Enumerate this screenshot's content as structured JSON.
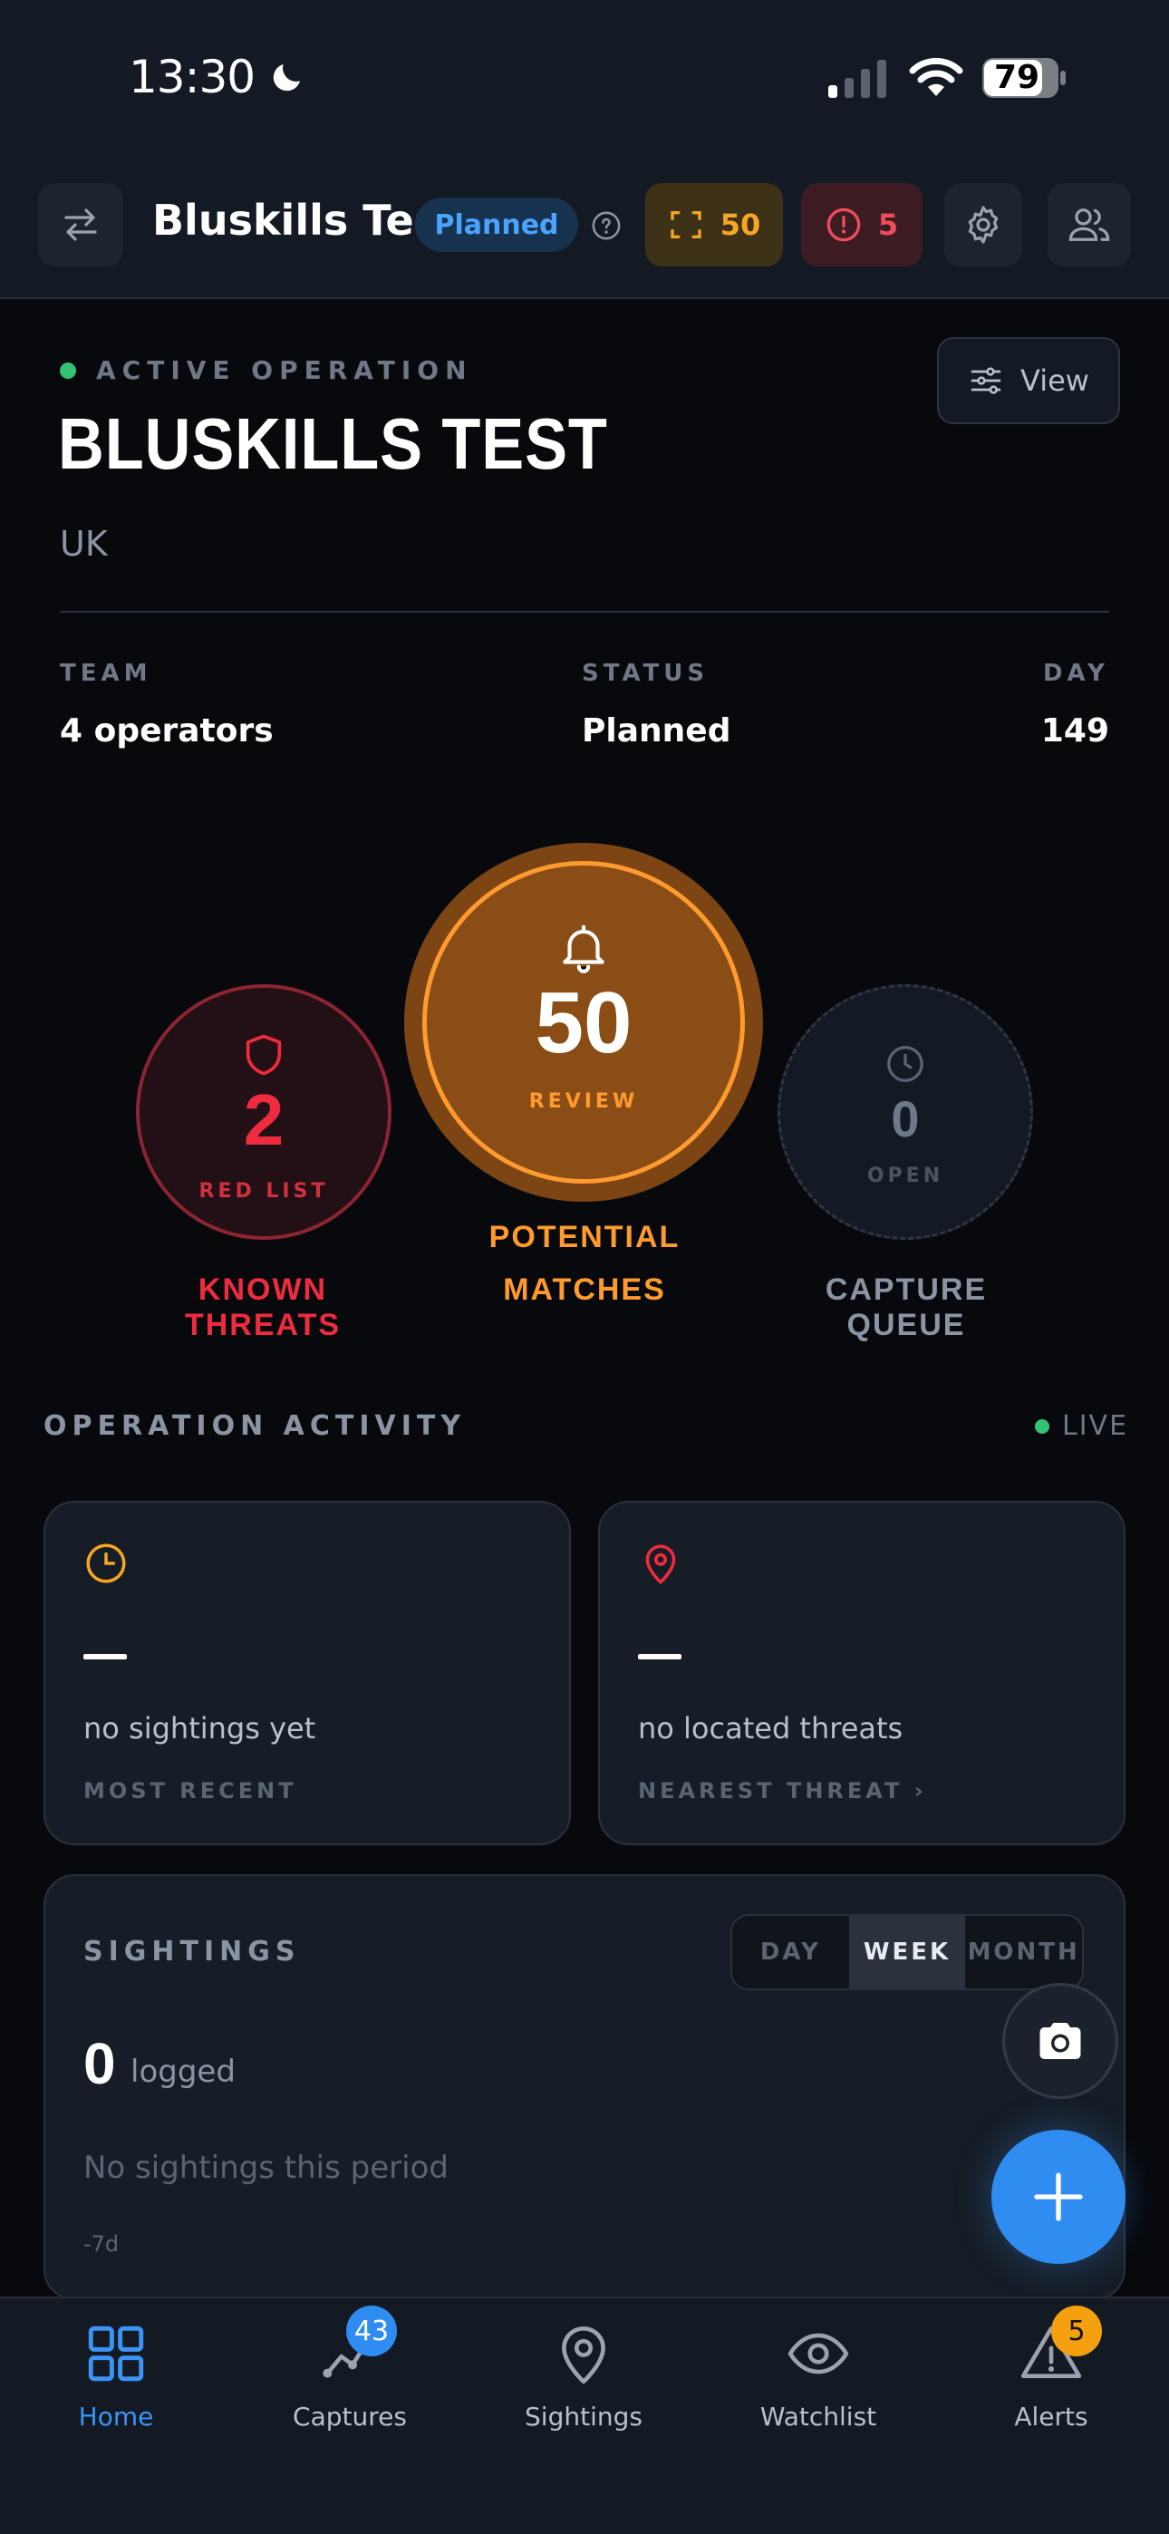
{
  "status_bar": {
    "time": "13:30",
    "battery": "79"
  },
  "header": {
    "title": "Bluskills Test",
    "status_badge": "Planned",
    "captures_count": "50",
    "alerts_count": "5"
  },
  "operation": {
    "label": "ACTIVE OPERATION",
    "title": "BLUSKILLS TEST",
    "location": "UK",
    "view_label": "View",
    "team_label": "TEAM",
    "team_value": "4 operators",
    "status_label": "STATUS",
    "status_value": "Planned",
    "day_label": "DAY",
    "day_value": "149"
  },
  "metrics": {
    "known_threats": {
      "value": "2",
      "sub": "RED LIST",
      "caption": "KNOWN THREATS"
    },
    "potential_matches": {
      "value": "50",
      "sub": "REVIEW",
      "caption_line1": "POTENTIAL",
      "caption_line2": "MATCHES"
    },
    "capture_queue": {
      "value": "0",
      "sub": "OPEN",
      "caption": "CAPTURE QUEUE"
    }
  },
  "activity": {
    "label": "OPERATION ACTIVITY",
    "live": "LIVE",
    "recent": {
      "value": "—",
      "text": "no sightings yet",
      "sub": "MOST RECENT"
    },
    "nearest": {
      "value": "—",
      "text": "no located threats",
      "sub": "NEAREST THREAT ›"
    }
  },
  "sightings": {
    "title": "SIGHTINGS",
    "tabs": [
      "DAY",
      "WEEK",
      "MONTH"
    ],
    "active_tab": "WEEK",
    "count": "0",
    "count_label": "logged",
    "empty": "No sightings this period",
    "range": "-7d"
  },
  "tabbar": {
    "items": [
      {
        "label": "Home",
        "icon": "grid-icon"
      },
      {
        "label": "Captures",
        "icon": "captures-icon",
        "badge": "43"
      },
      {
        "label": "Sightings",
        "icon": "map-pin-icon"
      },
      {
        "label": "Watchlist",
        "icon": "eye-icon"
      },
      {
        "label": "Alerts",
        "icon": "warning-icon",
        "badge": "5"
      }
    ]
  },
  "colors": {
    "accent_blue": "#2f8cf0",
    "threat_red": "#ef2b3f",
    "match_orange": "#ff9a2e",
    "live_green": "#34c274"
  }
}
